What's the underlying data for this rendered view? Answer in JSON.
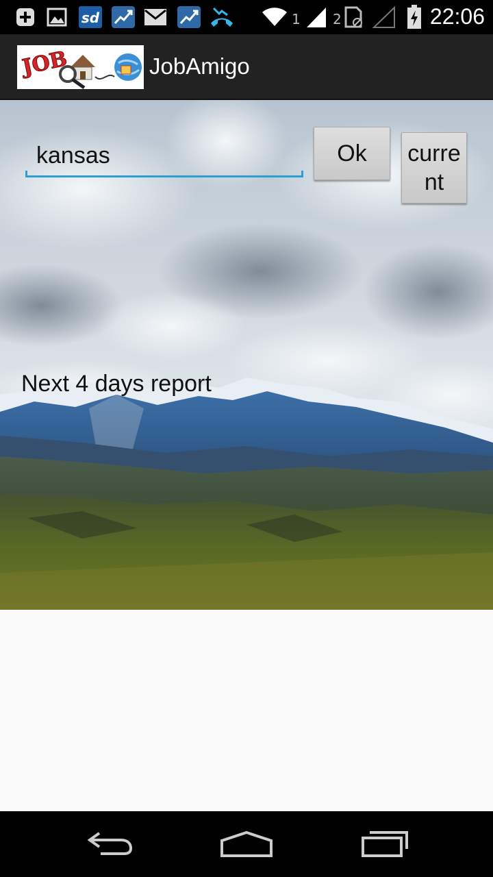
{
  "status_bar": {
    "sim1": "1",
    "sim2": "2",
    "time": "22:06",
    "icons": [
      "add-icon",
      "image-icon",
      "sd-icon",
      "stocks-icon",
      "mail-icon",
      "stocks-icon",
      "missed-call-icon",
      "wifi-icon",
      "signal-icon",
      "sim-data-icon",
      "no-signal-icon",
      "battery-charging-icon"
    ]
  },
  "action_bar": {
    "title": "JobAmigo",
    "logo_text": "JOB"
  },
  "search": {
    "value": "kansas",
    "placeholder": ""
  },
  "buttons": {
    "ok_label": "Ok",
    "current_label": "current"
  },
  "report": {
    "label": "Next 4 days report"
  },
  "navigation": {
    "icons": [
      "back-icon",
      "home-icon",
      "recent-apps-icon"
    ]
  },
  "colors": {
    "accent": "#2b9fd4",
    "action_bar": "#222222",
    "content_bg": "#fafafa"
  }
}
